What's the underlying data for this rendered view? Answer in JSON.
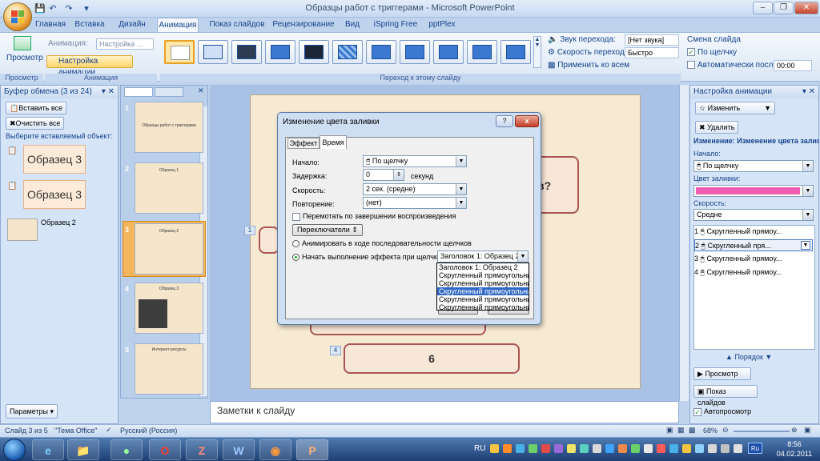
{
  "window": {
    "title": "Образцы работ с триггерами - Microsoft PowerPoint"
  },
  "tabs": [
    "Главная",
    "Вставка",
    "Дизайн",
    "Анимация",
    "Показ слайдов",
    "Рецензирование",
    "Вид",
    "iSpring Free",
    "pptPlex"
  ],
  "ribbon": {
    "preview_label": "Просмотр",
    "animation_label": "Анимация:",
    "animation_value": "Настройка ...",
    "custom_anim_label": "Настройка анимации",
    "group_preview": "Просмотр",
    "group_animation": "Анимация",
    "group_transition": "Переход к этому слайду",
    "sound_label": "Звук перехода:",
    "sound_value": "[Нет звука]",
    "speed_label": "Скорость перехода:",
    "speed_value": "Быстро",
    "apply_all": "Применить ко всем",
    "advance_title": "Смена слайда",
    "on_click": "По щелчку",
    "auto_after": "Автоматически после:",
    "auto_time": "00:00"
  },
  "clipboard": {
    "header": "Буфер обмена (3 из 24)",
    "paste_all": "Вставить все",
    "clear_all": "Очистить все",
    "select_prompt": "Выберите вставляемый объект:",
    "items": [
      "Образец 3",
      "Образец 3",
      "Образец 2"
    ],
    "params_button": "Параметры"
  },
  "slides": {
    "numbers": [
      "1",
      "2",
      "3",
      "4",
      "5"
    ],
    "t1": "Образцы работ с триггерами",
    "t2": "Образец 1",
    "t3": "Образец 2",
    "t4": "Образец 3",
    "t5": "Интернет-ресурсы"
  },
  "slide": {
    "q": "в?",
    "n6": "6",
    "b1": "1",
    "b4": "4"
  },
  "dialog": {
    "title": "Изменение цвета заливки",
    "help": "?",
    "close": "x",
    "tab_effect": "Эффект",
    "tab_timing": "Время",
    "start_label": "Начало:",
    "start_value": "По щелчку",
    "delay_label": "Задержка:",
    "delay_value": "0",
    "delay_unit": "секунд",
    "speed_label": "Скорость:",
    "speed_value": "2 сек. (средне)",
    "repeat_label": "Повторение:",
    "repeat_value": "(нет)",
    "rewind": "Перемотать по завершении воспроизведения",
    "triggers": "Переключатели",
    "animate_seq": "Анимировать в ходе последовательности щелчков",
    "start_on_click": "Начать выполнение эффекта при щелчке",
    "trigger_value": "Заголовок 1: Образец 2",
    "options": [
      "Заголовок 1: Образец 2",
      "Скругленный прямоугольник",
      "Скругленный прямоугольник",
      "Скругленный прямоугольник",
      "Скругленный прямоугольник",
      "Скругленный прямоугольник"
    ]
  },
  "anim_pane": {
    "header": "Настройка анимации",
    "change": "Изменить",
    "remove": "Удалить",
    "change_title": "Изменение: Изменение цвета залив",
    "start_label": "Начало:",
    "start_value": "По щелчку",
    "fill_label": "Цвет заливки:",
    "speed_label": "Скорость:",
    "speed_value": "Средне",
    "items": [
      {
        "n": "1",
        "t": "Скругленный прямоу..."
      },
      {
        "n": "2",
        "t": "Скругленный пря..."
      },
      {
        "n": "3",
        "t": "Скругленный прямоу..."
      },
      {
        "n": "4",
        "t": "Скругленный прямоу..."
      }
    ],
    "order": "Порядок",
    "preview": "Просмотр",
    "show": "Показ слайдов",
    "autopreview": "Автопросмотр",
    "fill_color": "#ee5fb1"
  },
  "notes": "Заметки к слайду",
  "status": {
    "slide": "Слайд 3 из 5",
    "theme": "\"Тема Office\"",
    "lang": "Русский (Россия)",
    "zoom": "68%"
  },
  "taskbar": {
    "lang": "RU",
    "time": "8:56",
    "date": "04.02.2011"
  }
}
